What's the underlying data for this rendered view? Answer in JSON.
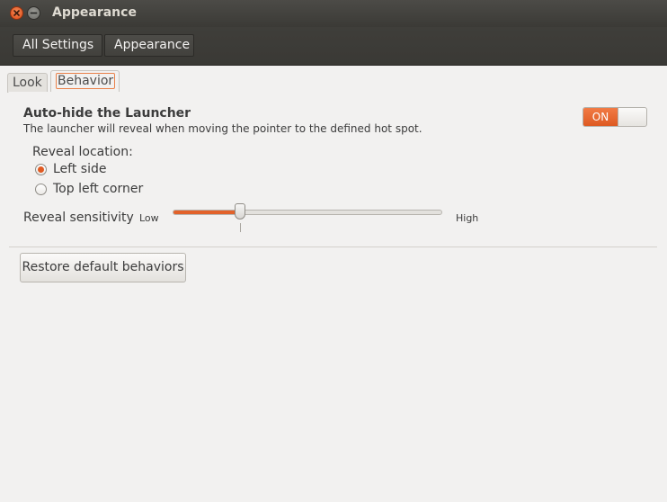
{
  "window": {
    "title": "Appearance"
  },
  "toolbar": {
    "breadcrumbs": [
      {
        "label": "All Settings"
      },
      {
        "label": "Appearance"
      }
    ]
  },
  "tabs": [
    {
      "label": "Look",
      "active": false
    },
    {
      "label": "Behavior",
      "active": true
    }
  ],
  "behavior": {
    "autohide_title": "Auto-hide the Launcher",
    "autohide_description": "The launcher will reveal when moving the pointer to the defined hot spot.",
    "autohide_toggle_label": "ON",
    "autohide_enabled": true,
    "reveal_location_label": "Reveal location:",
    "reveal_options": [
      {
        "label": "Left side",
        "selected": true
      },
      {
        "label": "Top left corner",
        "selected": false
      }
    ],
    "reveal_sensitivity_label": "Reveal sensitivity",
    "sensitivity_low_label": "Low",
    "sensitivity_high_label": "High",
    "sensitivity_level": 0.24,
    "restore_button_label": "Restore default behaviors"
  },
  "colors": {
    "accent": "#dd4814",
    "titlebar": "#3c3b37"
  }
}
